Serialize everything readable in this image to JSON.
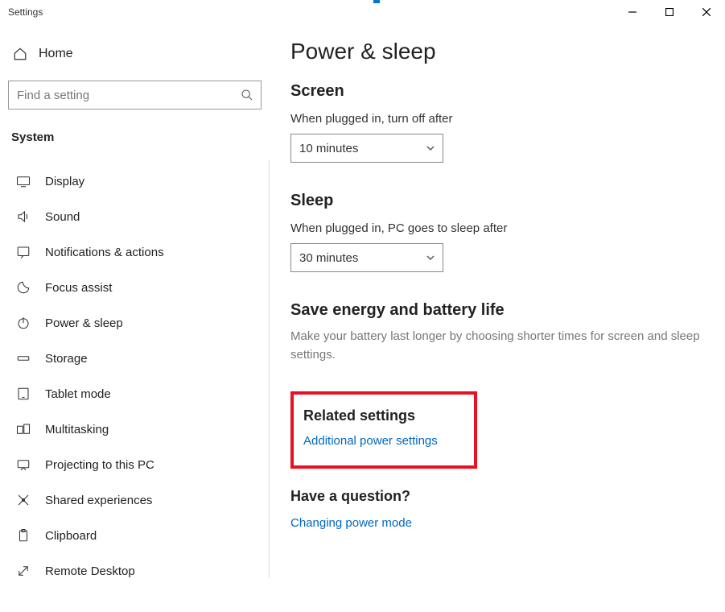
{
  "window": {
    "title": "Settings"
  },
  "sidebar": {
    "home": "Home",
    "search_placeholder": "Find a setting",
    "category": "System",
    "items": [
      {
        "label": "Display"
      },
      {
        "label": "Sound"
      },
      {
        "label": "Notifications & actions"
      },
      {
        "label": "Focus assist"
      },
      {
        "label": "Power & sleep"
      },
      {
        "label": "Storage"
      },
      {
        "label": "Tablet mode"
      },
      {
        "label": "Multitasking"
      },
      {
        "label": "Projecting to this PC"
      },
      {
        "label": "Shared experiences"
      },
      {
        "label": "Clipboard"
      },
      {
        "label": "Remote Desktop"
      }
    ]
  },
  "content": {
    "title": "Power & sleep",
    "screen": {
      "heading": "Screen",
      "label": "When plugged in, turn off after",
      "value": "10 minutes"
    },
    "sleep": {
      "heading": "Sleep",
      "label": "When plugged in, PC goes to sleep after",
      "value": "30 minutes"
    },
    "save": {
      "heading": "Save energy and battery life",
      "text": "Make your battery last longer by choosing shorter times for screen and sleep settings."
    },
    "related": {
      "heading": "Related settings",
      "link": "Additional power settings"
    },
    "question": {
      "heading": "Have a question?",
      "link": "Changing power mode"
    }
  }
}
